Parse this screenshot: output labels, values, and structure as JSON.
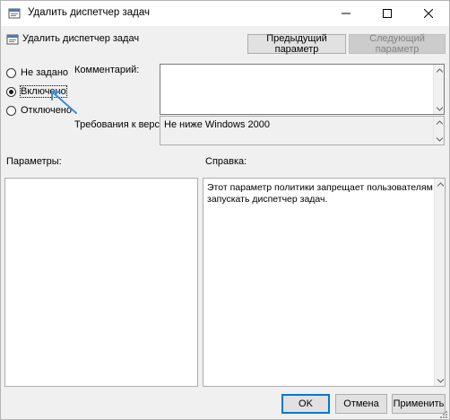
{
  "window": {
    "title": "Удалить диспетчер задач",
    "title_icon": "policy-icon",
    "controls": [
      "minimize-icon",
      "maximize-icon",
      "close-icon"
    ]
  },
  "header": {
    "title": "Удалить диспетчер задач",
    "icon": "policy-icon"
  },
  "nav": {
    "prev_label": "Предыдущий параметр",
    "next_label": "Следующий параметр",
    "next_disabled": true
  },
  "state": {
    "options": [
      {
        "label": "Не задано",
        "checked": false
      },
      {
        "label": "Включено",
        "checked": true
      },
      {
        "label": "Отключено",
        "checked": false
      }
    ]
  },
  "comment": {
    "label": "Комментарий:",
    "value": ""
  },
  "supported": {
    "label": "Требования к версии:",
    "value": "Не ниже Windows 2000"
  },
  "params": {
    "label": "Параметры:"
  },
  "help": {
    "label": "Справка:",
    "text": "Этот параметр политики запрещает пользователям запускать диспетчер задач."
  },
  "footer": {
    "ok_label": "OK",
    "cancel_label": "Отмена",
    "apply_label": "Применить"
  },
  "colors": {
    "accent": "#0078d7",
    "annotation_arrow": "#3a8fd6",
    "window_bg": "#f0f0f0"
  }
}
